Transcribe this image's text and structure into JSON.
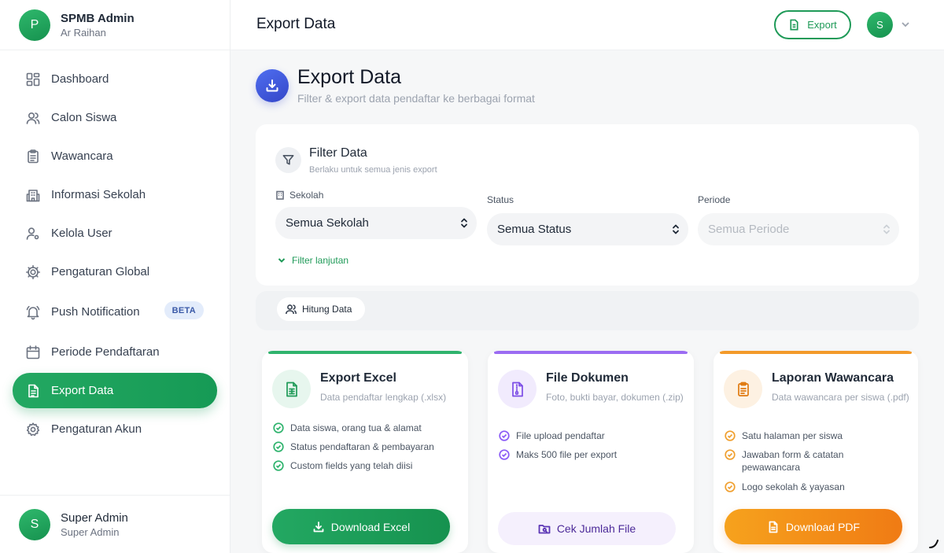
{
  "sidebar": {
    "app_initial": "P",
    "app_title": "SPMB Admin",
    "app_subtitle": "Ar Raihan",
    "items": [
      {
        "label": "Dashboard",
        "icon": "grid-icon"
      },
      {
        "label": "Calon Siswa",
        "icon": "users-icon"
      },
      {
        "label": "Wawancara",
        "icon": "clipboard-icon"
      },
      {
        "label": "Informasi Sekolah",
        "icon": "building-icon"
      },
      {
        "label": "Kelola User",
        "icon": "user-gear-icon"
      },
      {
        "label": "Pengaturan Global",
        "icon": "settings-icon"
      },
      {
        "label": "Push Notification",
        "icon": "bell-icon",
        "badge": "BETA"
      },
      {
        "label": "Periode Pendaftaran",
        "icon": "calendar-icon"
      },
      {
        "label": "Export Data",
        "icon": "file-icon",
        "active": true
      },
      {
        "label": "Pengaturan Akun",
        "icon": "gear-icon"
      }
    ],
    "footer": {
      "initial": "S",
      "name": "Super Admin",
      "role": "Super Admin"
    }
  },
  "topbar": {
    "title": "Export Data",
    "export_label": "Export",
    "avatar_initial": "S"
  },
  "page": {
    "title": "Export Data",
    "subtitle": "Filter & export data pendaftar ke berbagai format"
  },
  "filter": {
    "title": "Filter Data",
    "subtitle": "Berlaku untuk semua jenis export",
    "sekolah_label": "Sekolah",
    "sekolah_value": "Semua Sekolah",
    "status_label": "Status",
    "status_value": "Semua Status",
    "periode_label": "Periode",
    "periode_placeholder": "Semua Periode",
    "advanced_label": "Filter lanjutan",
    "count_label": "Hitung Data"
  },
  "cards": [
    {
      "title": "Export Excel",
      "desc": "Data pendaftar lengkap (.xlsx)",
      "features": [
        "Data siswa, orang tua & alamat",
        "Status pendaftaran & pembayaran",
        "Custom fields yang telah diisi"
      ],
      "button": "Download Excel",
      "accent": "#1f9a58"
    },
    {
      "title": "File Dokumen",
      "desc": "Foto, bukti bayar, dokumen (.zip)",
      "features": [
        "File upload pendaftar",
        "Maks 500 file per export"
      ],
      "button": "Cek Jumlah File",
      "accent": "#8b5cf6"
    },
    {
      "title": "Laporan Wawancara",
      "desc": "Data wawancara per siswa (.pdf)",
      "features": [
        "Satu halaman per siswa",
        "Jawaban form & catatan pewawancara",
        "Logo sekolah & yayasan"
      ],
      "button": "Download PDF",
      "accent": "#f08a1c"
    }
  ]
}
